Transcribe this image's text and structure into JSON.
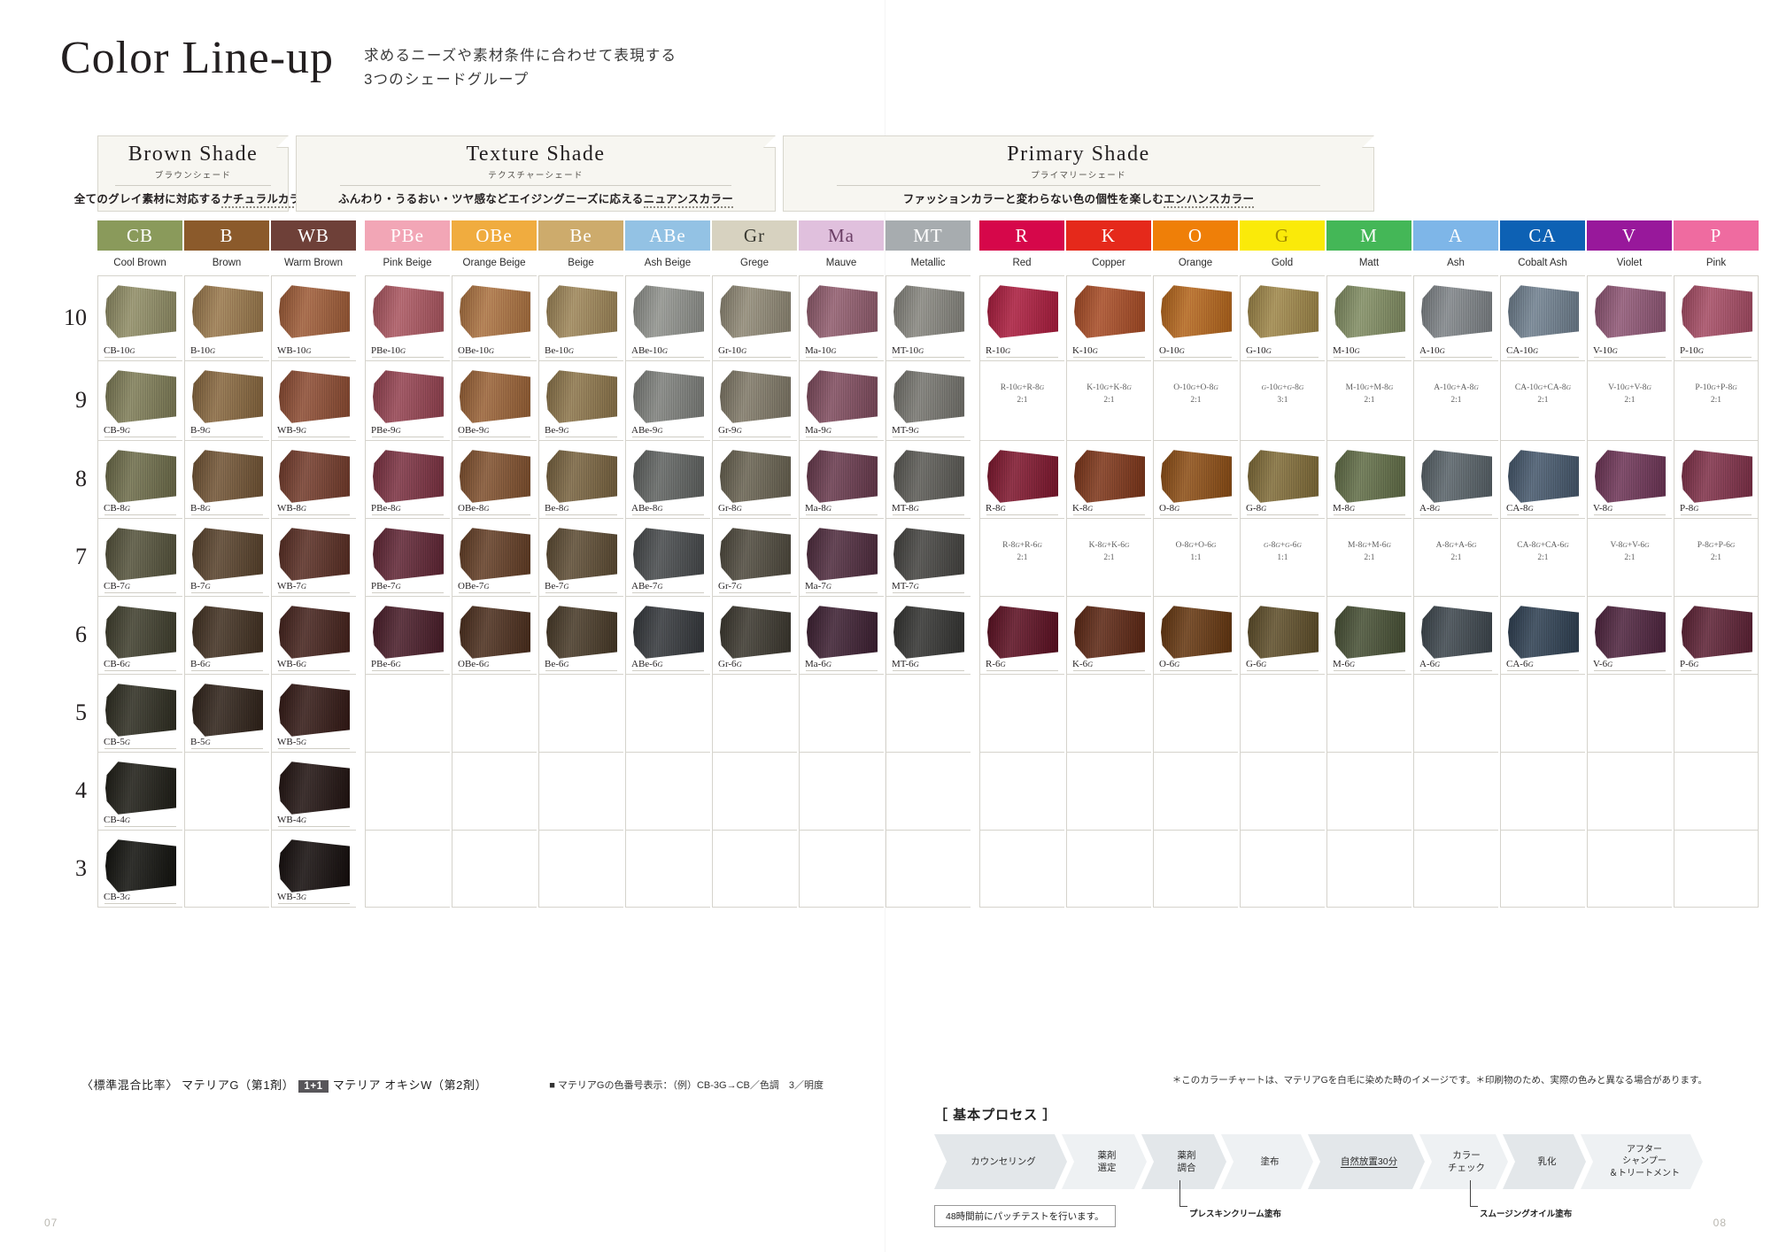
{
  "header": {
    "title": "Color Line-up",
    "subtitle_line1": "求めるニーズや素材条件に合わせて表現する",
    "subtitle_line2": "3つのシェードグループ"
  },
  "groups": [
    {
      "en": "Brown Shade",
      "jp": "ブラウンシェード",
      "desc_plain": "全てのグレイ素材に対応する",
      "desc_em": "ナチュラルカラー"
    },
    {
      "en": "Texture Shade",
      "jp": "テクスチャーシェード",
      "desc_plain": "ふんわり・うるおい・ツヤ感などエイジングニーズに応える",
      "desc_em": "ニュアンスカラー"
    },
    {
      "en": "Primary Shade",
      "jp": "プライマリーシェード",
      "desc_plain": "ファッションカラーと変わらない色の個性を楽しむ",
      "desc_em": "エンハンスカラー"
    }
  ],
  "columns": [
    {
      "code": "CB",
      "name": "Cool Brown",
      "chip": "#8a9a5b",
      "text": "#ffffff",
      "group": 0
    },
    {
      "code": "B",
      "name": "Brown",
      "chip": "#8b5a2b",
      "text": "#ffffff",
      "group": 0
    },
    {
      "code": "WB",
      "name": "Warm Brown",
      "chip": "#6e4038",
      "text": "#ffffff",
      "group": 0
    },
    {
      "code": "PBe",
      "name": "Pink Beige",
      "chip": "#f2a6b6",
      "text": "#ffffff",
      "group": 1
    },
    {
      "code": "OBe",
      "name": "Orange Beige",
      "chip": "#f0ac3f",
      "text": "#ffffff",
      "group": 1
    },
    {
      "code": "Be",
      "name": "Beige",
      "chip": "#cdab6c",
      "text": "#ffffff",
      "group": 1
    },
    {
      "code": "ABe",
      "name": "Ash Beige",
      "chip": "#93c2e4",
      "text": "#ffffff",
      "group": 1
    },
    {
      "code": "Gr",
      "name": "Grege",
      "chip": "#d7d2c0",
      "text": "#3b3b33",
      "group": 1
    },
    {
      "code": "Ma",
      "name": "Mauve",
      "chip": "#e0c0dd",
      "text": "#6b3f66",
      "group": 1
    },
    {
      "code": "MT",
      "name": "Metallic",
      "chip": "#a7acaf",
      "text": "#ffffff",
      "group": 1
    },
    {
      "code": "R",
      "name": "Red",
      "chip": "#d6074a",
      "text": "#ffffff",
      "group": 2
    },
    {
      "code": "K",
      "name": "Copper",
      "chip": "#e5291b",
      "text": "#ffffff",
      "group": 2
    },
    {
      "code": "O",
      "name": "Orange",
      "chip": "#ef7f08",
      "text": "#ffffff",
      "group": 2
    },
    {
      "code": "G",
      "name": "Gold",
      "chip": "#faea09",
      "text": "#a08a00",
      "group": 2
    },
    {
      "code": "M",
      "name": "Matt",
      "chip": "#44b757",
      "text": "#ffffff",
      "group": 2
    },
    {
      "code": "A",
      "name": "Ash",
      "chip": "#7eb6e8",
      "text": "#ffffff",
      "group": 2
    },
    {
      "code": "CA",
      "name": "Cobalt Ash",
      "chip": "#0d61b4",
      "text": "#ffffff",
      "group": 2
    },
    {
      "code": "V",
      "name": "Violet",
      "chip": "#98189b",
      "text": "#ffffff",
      "group": 2
    },
    {
      "code": "P",
      "name": "Pink",
      "chip": "#ef6ba0",
      "text": "#ffffff",
      "group": 2
    }
  ],
  "levels": [
    "10",
    "9",
    "8",
    "7",
    "6",
    "5",
    "4",
    "3"
  ],
  "grid": [
    [
      {
        "label": "CB-10",
        "g": "G",
        "color": "#8d8a63"
      },
      {
        "label": "B-10",
        "g": "G",
        "color": "#97764a"
      },
      {
        "label": "WB-10",
        "g": "G",
        "color": "#9c5a36"
      },
      {
        "label": "PBe-10",
        "g": "G",
        "color": "#a8545e"
      },
      {
        "label": "OBe-10",
        "g": "G",
        "color": "#a9703f"
      },
      {
        "label": "Be-10",
        "g": "G",
        "color": "#9b8356"
      },
      {
        "label": "ABe-10",
        "g": "G",
        "color": "#8d8f8a"
      },
      {
        "label": "Gr-10",
        "g": "G",
        "color": "#8d8673"
      },
      {
        "label": "Ma-10",
        "g": "G",
        "color": "#8e5a6b"
      },
      {
        "label": "MT-10",
        "g": "G",
        "color": "#84837c"
      },
      {
        "label": "R-10",
        "g": "G",
        "color": "#a81b3c"
      },
      {
        "label": "K-10",
        "g": "G",
        "color": "#a54a24"
      },
      {
        "label": "O-10",
        "g": "G",
        "color": "#b2641b"
      },
      {
        "label": "G-10",
        "g": "G",
        "color": "#9c8447"
      },
      {
        "label": "M-10",
        "g": "G",
        "color": "#7e8a60"
      },
      {
        "label": "A-10",
        "g": "G",
        "color": "#7c8185"
      },
      {
        "label": "CA-10",
        "g": "G",
        "color": "#6d7d8c"
      },
      {
        "label": "V-10",
        "g": "G",
        "color": "#8c5472"
      },
      {
        "label": "P-10",
        "g": "G",
        "color": "#a34a62"
      }
    ],
    [
      {
        "label": "CB-9",
        "g": "G",
        "color": "#7c7a55"
      },
      {
        "label": "B-9",
        "g": "G",
        "color": "#85653d"
      },
      {
        "label": "WB-9",
        "g": "G",
        "color": "#8a4a31"
      },
      {
        "label": "PBe-9",
        "g": "G",
        "color": "#92414f"
      },
      {
        "label": "OBe-9",
        "g": "G",
        "color": "#976035"
      },
      {
        "label": "Be-9",
        "g": "G",
        "color": "#8a7349"
      },
      {
        "label": "ABe-9",
        "g": "G",
        "color": "#7b7d79"
      },
      {
        "label": "Gr-9",
        "g": "G",
        "color": "#7d7665"
      },
      {
        "label": "Ma-9",
        "g": "G",
        "color": "#7d4a5c"
      },
      {
        "label": "MT-9",
        "g": "G",
        "color": "#73726c"
      },
      {
        "mix": [
          "R-10G+R-8G",
          "2:1"
        ]
      },
      {
        "mix": [
          "K-10G+K-8G",
          "2:1"
        ]
      },
      {
        "mix": [
          "O-10G+O-8G",
          "2:1"
        ]
      },
      {
        "mix": [
          "G-10G+G-8G",
          "3:1"
        ]
      },
      {
        "mix": [
          "M-10G+M-8G",
          "2:1"
        ]
      },
      {
        "mix": [
          "A-10G+A-8G",
          "2:1"
        ]
      },
      {
        "mix": [
          "CA-10G+CA-8G",
          "2:1"
        ]
      },
      {
        "mix": [
          "V-10G+V-8G",
          "2:1"
        ]
      },
      {
        "mix": [
          "P-10G+P-8G",
          "2:1"
        ]
      }
    ],
    [
      {
        "label": "CB-8",
        "g": "G",
        "color": "#6b6a48"
      },
      {
        "label": "B-8",
        "g": "G",
        "color": "#6f5233"
      },
      {
        "label": "WB-8",
        "g": "G",
        "color": "#713a2a"
      },
      {
        "label": "PBe-8",
        "g": "G",
        "color": "#793040"
      },
      {
        "label": "OBe-8",
        "g": "G",
        "color": "#7e4f2d"
      },
      {
        "label": "Be-8",
        "g": "G",
        "color": "#76613e"
      },
      {
        "label": "ABe-8",
        "g": "G",
        "color": "#5e615f"
      },
      {
        "label": "Gr-8",
        "g": "G",
        "color": "#66604f"
      },
      {
        "label": "Ma-8",
        "g": "G",
        "color": "#66384b"
      },
      {
        "label": "MT-8",
        "g": "G",
        "color": "#595853"
      },
      {
        "label": "R-8",
        "g": "G",
        "color": "#7c152c"
      },
      {
        "label": "K-8",
        "g": "G",
        "color": "#7b3418"
      },
      {
        "label": "O-8",
        "g": "G",
        "color": "#8a4c14"
      },
      {
        "label": "G-8",
        "g": "G",
        "color": "#7e6a37"
      },
      {
        "label": "M-8",
        "g": "G",
        "color": "#5f6b45"
      },
      {
        "label": "A-8",
        "g": "G",
        "color": "#566066"
      },
      {
        "label": "CA-8",
        "g": "G",
        "color": "#44566a"
      },
      {
        "label": "V-8",
        "g": "G",
        "color": "#6b3354"
      },
      {
        "label": "P-8",
        "g": "G",
        "color": "#7d2f47"
      }
    ],
    [
      {
        "label": "CB-7",
        "g": "G",
        "color": "#53513a"
      },
      {
        "label": "B-7",
        "g": "G",
        "color": "#56402a"
      },
      {
        "label": "WB-7",
        "g": "G",
        "color": "#572c22"
      },
      {
        "label": "PBe-7",
        "g": "G",
        "color": "#5e2433"
      },
      {
        "label": "OBe-7",
        "g": "G",
        "color": "#613c24"
      },
      {
        "label": "Be-7",
        "g": "G",
        "color": "#5b4a32"
      },
      {
        "label": "ABe-7",
        "g": "G",
        "color": "#45484a"
      },
      {
        "label": "Gr-7",
        "g": "G",
        "color": "#4d483c"
      },
      {
        "label": "Ma-7",
        "g": "G",
        "color": "#4d2a3c"
      },
      {
        "label": "MT-7",
        "g": "G",
        "color": "#43423f"
      },
      {
        "mix": [
          "R-8G+R-6G",
          "2:1"
        ]
      },
      {
        "mix": [
          "K-8G+K-6G",
          "2:1"
        ]
      },
      {
        "mix": [
          "O-8G+O-6G",
          "1:1"
        ]
      },
      {
        "mix": [
          "G-8G+G-6G",
          "1:1"
        ]
      },
      {
        "mix": [
          "M-8G+M-6G",
          "2:1"
        ]
      },
      {
        "mix": [
          "A-8G+A-6G",
          "2:1"
        ]
      },
      {
        "mix": [
          "CA-8G+CA-6G",
          "2:1"
        ]
      },
      {
        "mix": [
          "V-8G+V-6G",
          "2:1"
        ]
      },
      {
        "mix": [
          "P-8G+P-6G",
          "2:1"
        ]
      }
    ],
    [
      {
        "label": "CB-6",
        "g": "G",
        "color": "#3e3d2c"
      },
      {
        "label": "B-6",
        "g": "G",
        "color": "#402f20"
      },
      {
        "label": "WB-6",
        "g": "G",
        "color": "#43211b"
      },
      {
        "label": "PBe-6",
        "g": "G",
        "color": "#471b27"
      },
      {
        "label": "OBe-6",
        "g": "G",
        "color": "#4a2d1c"
      },
      {
        "label": "Be-6",
        "g": "G",
        "color": "#463826"
      },
      {
        "label": "ABe-6",
        "g": "G",
        "color": "#33363a"
      },
      {
        "label": "Gr-6",
        "g": "G",
        "color": "#3a362d"
      },
      {
        "label": "Ma-6",
        "g": "G",
        "color": "#3b1e30"
      },
      {
        "label": "MT-6",
        "g": "G",
        "color": "#323230"
      },
      {
        "label": "R-6",
        "g": "G",
        "color": "#5a0e20"
      },
      {
        "label": "K-6",
        "g": "G",
        "color": "#5a2512"
      },
      {
        "label": "O-6",
        "g": "G",
        "color": "#63350f"
      },
      {
        "label": "G-6",
        "g": "G",
        "color": "#5c4c28"
      },
      {
        "label": "M-6",
        "g": "G",
        "color": "#454e33"
      },
      {
        "label": "A-6",
        "g": "G",
        "color": "#3c454c"
      },
      {
        "label": "CA-6",
        "g": "G",
        "color": "#2d3e50"
      },
      {
        "label": "V-6",
        "g": "G",
        "color": "#4c223c"
      },
      {
        "label": "P-6",
        "g": "G",
        "color": "#5b2033"
      }
    ],
    [
      {
        "label": "CB-5",
        "g": "G",
        "color": "#2d2c20"
      },
      {
        "label": "B-5",
        "g": "G",
        "color": "#2e2118"
      },
      {
        "label": "WB-5",
        "g": "G",
        "color": "#321814"
      },
      null,
      null,
      null,
      null,
      null,
      null,
      null,
      null,
      null,
      null,
      null,
      null,
      null,
      null,
      null,
      null
    ],
    [
      {
        "label": "CB-4",
        "g": "G",
        "color": "#1d1c15"
      },
      null,
      {
        "label": "WB-4",
        "g": "G",
        "color": "#201210"
      },
      null,
      null,
      null,
      null,
      null,
      null,
      null,
      null,
      null,
      null,
      null,
      null,
      null,
      null,
      null,
      null
    ],
    [
      {
        "label": "CB-3",
        "g": "G",
        "color": "#11110d"
      },
      null,
      {
        "label": "WB-3",
        "g": "G",
        "color": "#130c0b"
      },
      null,
      null,
      null,
      null,
      null,
      null,
      null,
      null,
      null,
      null,
      null,
      null,
      null,
      null,
      null,
      null
    ]
  ],
  "footer": {
    "ratio_label": "〈標準混合比率〉",
    "ratio_part1": "マテリアG（第1剤）",
    "ratio_badge": "1+1",
    "ratio_part2": "マテリア オキシW（第2剤）",
    "code_note": "■ マテリアGの色番号表示：（例）CB-3G→CB／色調　3／明度",
    "disclaimer_line1": "＊このカラーチャートは、マテリアGを白毛に染めた時のイメージです。＊印刷物のため、実際の色みと異なる場合があります。"
  },
  "process": {
    "title": "［ 基本プロセス ］",
    "steps": [
      {
        "lines": [
          "カウンセリング"
        ]
      },
      {
        "lines": [
          "薬剤",
          "選定"
        ]
      },
      {
        "lines": [
          "薬剤",
          "調合"
        ]
      },
      {
        "lines": [
          "塗布"
        ]
      },
      {
        "lines": [
          "自然放置30分"
        ],
        "underline": true
      },
      {
        "lines": [
          "カラー",
          "チェック"
        ]
      },
      {
        "lines": [
          "乳化"
        ]
      },
      {
        "lines": [
          "アフター",
          "シャンプー",
          "＆トリートメント"
        ]
      }
    ],
    "patch_test": "48時間前にパッチテストを行います。",
    "callout_1": "プレスキンクリーム塗布",
    "callout_2": "スムージングオイル塗布"
  },
  "page_numbers": {
    "left": "07",
    "right": "08"
  }
}
